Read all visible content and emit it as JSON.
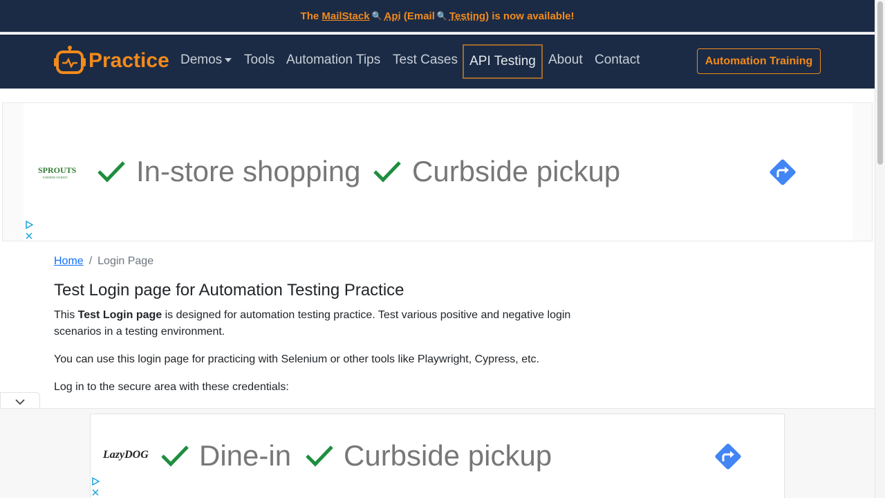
{
  "announcement": {
    "prefix": "The",
    "link1": "MailStack",
    "link2": "Api",
    "middle": "(Email",
    "link3": "Testing",
    "suffix": ") is now available!",
    "icon": "magnifier-icon"
  },
  "brand": {
    "name": "Practice",
    "logo_icon": "robot-icon"
  },
  "nav": {
    "demos": "Demos",
    "tools": "Tools",
    "automation_tips": "Automation Tips",
    "test_cases": "Test Cases",
    "api_testing": "API Testing",
    "about": "About",
    "contact": "Contact",
    "cta": "Automation Training"
  },
  "ad_top": {
    "logo": "SPROUTS",
    "logo_sub": "FARMERS MARKET",
    "feature1": "In-store shopping",
    "feature2": "Curbside pickup",
    "check_icon": "check-icon",
    "directions_icon": "directions-icon"
  },
  "breadcrumb": {
    "home": "Home",
    "separator": "/",
    "current": "Login Page"
  },
  "content": {
    "title": "Test Login page for Automation Testing Practice",
    "p1_before": "This ",
    "p1_bold": "Test Login page",
    "p1_after": " is designed for automation testing practice. Test various positive and negative login scenarios in a testing environment.",
    "p2": "You can use this login page for practicing with Selenium or other tools like Playwright, Cypress, etc.",
    "p3": "Log in to the secure area with these credentials:"
  },
  "ad_bottom": {
    "logo": "LazyDOG",
    "feature1": "Dine-in",
    "feature2": "Curbside pickup"
  },
  "colors": {
    "navy": "#1b2b45",
    "orange": "#f28a1c",
    "link": "#0d6efd"
  }
}
